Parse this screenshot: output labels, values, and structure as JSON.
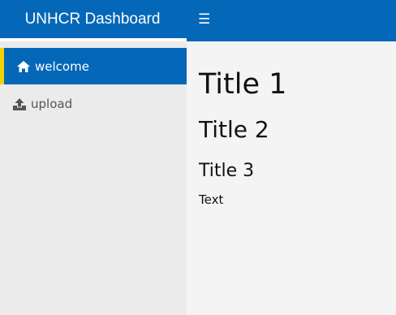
{
  "header": {
    "title": "UNHCR Dashboard",
    "toggle_icon": "hamburger-menu-icon",
    "brand_color": "#0467b8",
    "accent_color": "#f4d200"
  },
  "sidebar": {
    "items": [
      {
        "label": "welcome",
        "icon": "home-icon",
        "active": true
      },
      {
        "label": "upload",
        "icon": "upload-icon",
        "active": false
      }
    ]
  },
  "main": {
    "title1": "Title 1",
    "title2": "Title 2",
    "title3": "Title 3",
    "text": "Text"
  }
}
